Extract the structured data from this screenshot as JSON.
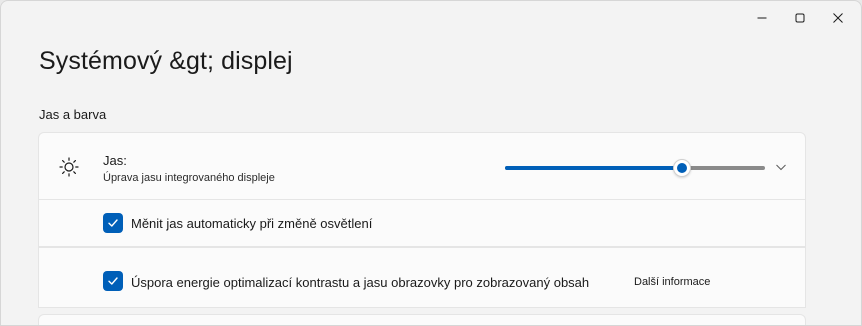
{
  "window": {
    "controls": {
      "minimize_icon": "minimize-icon",
      "maximize_icon": "maximize-icon",
      "close_icon": "close-icon"
    }
  },
  "header": {
    "title": "Systémový &gt; displej"
  },
  "section": {
    "label": "Jas a barva"
  },
  "brightness": {
    "icon": "sun-icon",
    "title": "Jas:",
    "description": "Úprava jasu integrovaného displeje",
    "value_fraction": 0.68,
    "chevron_icon": "chevron-down-icon"
  },
  "options": {
    "auto_brightness": {
      "label": "Měnit jas automaticky při změně osvětlení",
      "checked": true
    },
    "power_saver": {
      "label": "Úspora energie optimalizací kontrastu a jasu obrazovky pro zobrazovaný obsah",
      "checked": true,
      "link": "Další informace"
    }
  },
  "colors": {
    "accent": "#005fb8",
    "background": "#f3f3f3",
    "card": "#fbfbfb"
  }
}
